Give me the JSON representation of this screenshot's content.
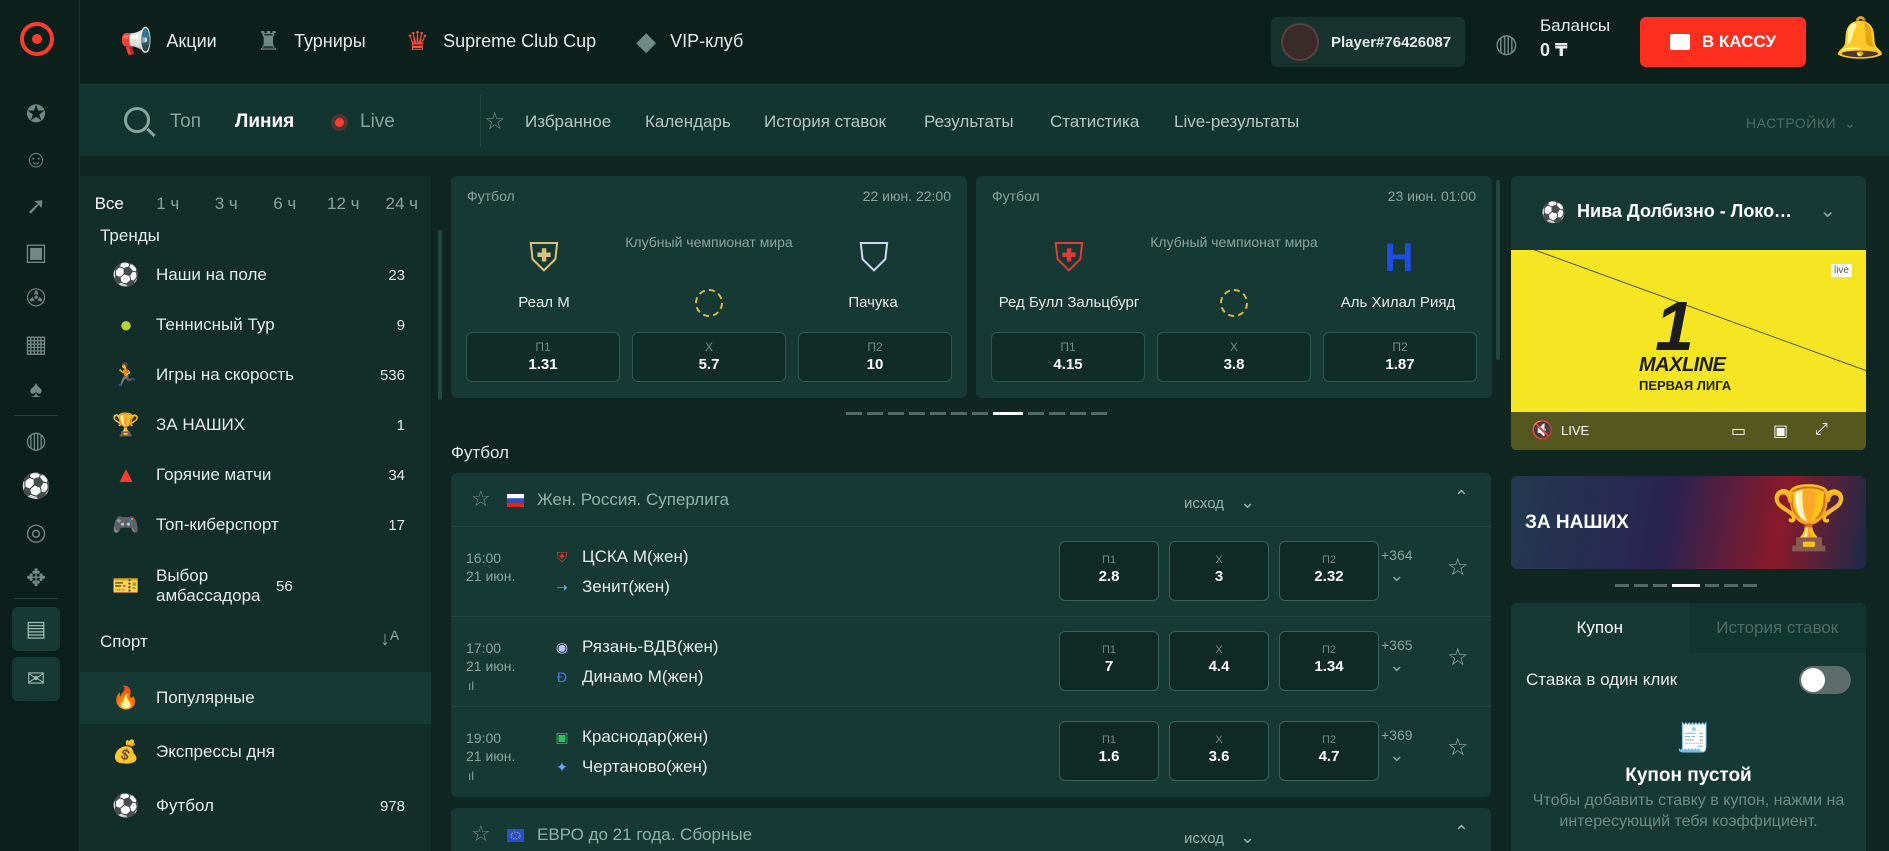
{
  "header": {
    "nav": [
      {
        "label": "Акции",
        "icon": "megaphone-icon"
      },
      {
        "label": "Турниры",
        "icon": "trophy-icon"
      },
      {
        "label": "Supreme Club Cup",
        "icon": "club-cup-icon"
      },
      {
        "label": "VIP-клуб",
        "icon": "diamond-icon"
      }
    ],
    "player_name": "Player#76426087",
    "balance_label": "Балансы",
    "balance_value": "0 ₸",
    "cash_button": "В КАССУ"
  },
  "subnav": {
    "tabs": [
      "Топ",
      "Линия",
      "Live"
    ],
    "active_tab": "Линия",
    "links": [
      "Избранное",
      "Календарь",
      "История ставок",
      "Результаты",
      "Статистика",
      "Live-результаты"
    ],
    "settings": "НАСТРОЙКИ"
  },
  "left": {
    "periods": [
      "Все",
      "1 ч",
      "3 ч",
      "6 ч",
      "12 ч",
      "24 ч"
    ],
    "trends_title": "Тренды",
    "trends": [
      {
        "label": "Наши на поле",
        "count": "23",
        "icon": "football-player-icon"
      },
      {
        "label": "Теннисный Тур",
        "count": "9",
        "icon": "tennis-ball-icon"
      },
      {
        "label": "Игры на скорость",
        "count": "536",
        "icon": "running-icon"
      },
      {
        "label": "ЗА НАШИХ",
        "count": "1",
        "icon": "cup-icon"
      },
      {
        "label": "Горячие матчи",
        "count": "34",
        "icon": "warning-icon"
      },
      {
        "label": "Топ-киберспорт",
        "count": "17",
        "icon": "gamepad-icon"
      },
      {
        "label": "Выбор амбассадора",
        "count": "56",
        "icon": "ticket-icon"
      }
    ],
    "sport_title": "Спорт",
    "sort_label": "А Я",
    "sports": [
      {
        "label": "Популярные",
        "count": "",
        "icon": "fire-icon"
      },
      {
        "label": "Экспрессы дня",
        "count": "",
        "icon": "money-bag-icon"
      },
      {
        "label": "Футбол",
        "count": "978",
        "icon": "football-icon"
      }
    ]
  },
  "featured": [
    {
      "sport": "Футбол",
      "date": "22 июн. 22:00",
      "home": "Реал М",
      "away": "Пачука",
      "competition": "Клубный чемпионат мира",
      "odds": [
        {
          "label": "П1",
          "value": "1.31"
        },
        {
          "label": "Х",
          "value": "5.7"
        },
        {
          "label": "П2",
          "value": "10"
        }
      ]
    },
    {
      "sport": "Футбол",
      "date": "23 июн. 01:00",
      "home": "Ред Булл Зальцбург",
      "away": "Аль Хилал Рияд",
      "competition": "Клубный чемпионат мира",
      "odds": [
        {
          "label": "П1",
          "value": "4.15"
        },
        {
          "label": "Х",
          "value": "3.8"
        },
        {
          "label": "П2",
          "value": "1.87"
        }
      ]
    }
  ],
  "section_title": "Футбол",
  "leagues": [
    {
      "name": "Жен. Россия. Суперлига",
      "market": "исход",
      "matches": [
        {
          "time": "16:00",
          "date": "21 июн.",
          "home": "ЦСКА М(жен)",
          "away": "Зенит(жен)",
          "p1": "2.8",
          "x": "3",
          "p2": "2.32",
          "more": "+364"
        },
        {
          "time": "17:00",
          "date": "21 июн.",
          "home": "Рязань-ВДВ(жен)",
          "away": "Динамо М(жен)",
          "p1": "7",
          "x": "4.4",
          "p2": "1.34",
          "more": "+365"
        },
        {
          "time": "19:00",
          "date": "21 июн.",
          "home": "Краснодар(жен)",
          "away": "Чертаново(жен)",
          "p1": "1.6",
          "x": "3.6",
          "p2": "4.7",
          "more": "+369"
        }
      ]
    },
    {
      "name": "ЕВРО до 21 года. Сборные",
      "market": "исход",
      "matches": []
    }
  ],
  "odd_labels": {
    "p1": "П1",
    "x": "Х",
    "p2": "П2"
  },
  "right": {
    "stream_title": "Нива Долбизно - Локомотив",
    "stream_live": "LIVE",
    "stream_brand": "MAXLINE",
    "stream_brand_sub": "ПЕРВАЯ ЛИГА",
    "stream_badge": "live",
    "promo": "ЗА НАШИХ",
    "coupon_tabs": [
      "Купон",
      "История ставок"
    ],
    "one_click": "Ставка в один клик",
    "coupon_empty": "Купон пустой",
    "coupon_hint": "Чтобы добавить ставку в купон, нажми на интересующий тебя коэффициент."
  },
  "colors": {
    "accent": "#ff2f1f",
    "bg": "#0f2621",
    "panel": "#163a33"
  }
}
